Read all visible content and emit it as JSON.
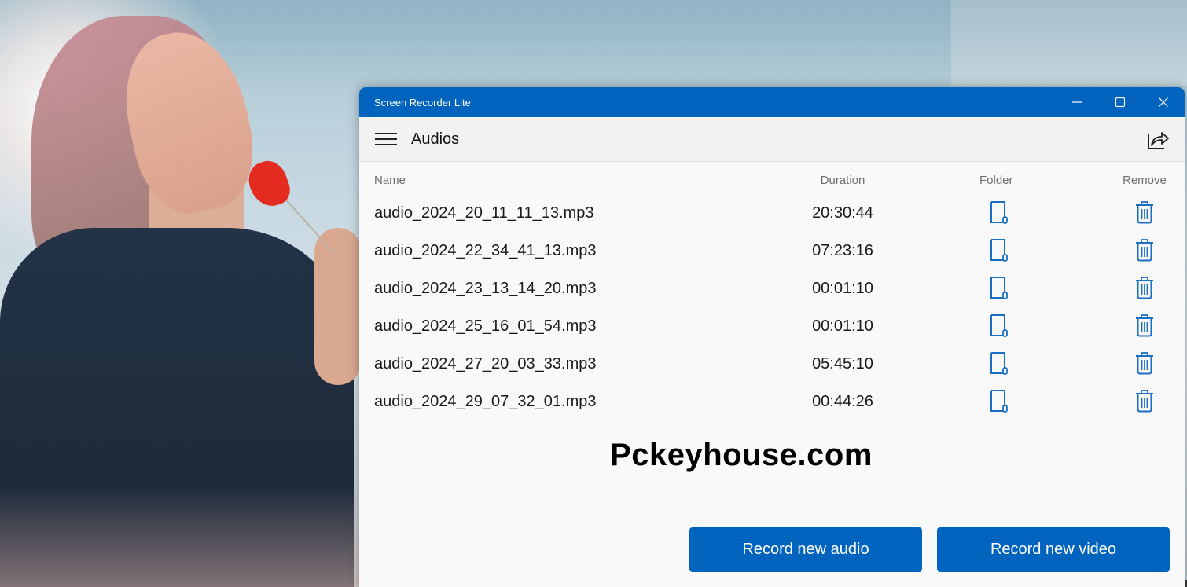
{
  "window": {
    "title": "Screen Recorder Lite",
    "controls": {
      "minimize": "minimize-icon",
      "maximize": "maximize-icon",
      "close": "close-icon"
    }
  },
  "appbar": {
    "menu_icon": "hamburger-menu-icon",
    "title": "Audios",
    "share_icon": "share-icon"
  },
  "table": {
    "columns": [
      "Name",
      "Duration",
      "Folder",
      "Remove"
    ],
    "rows": [
      {
        "name": "audio_2024_20_11_11_13.mp3",
        "duration": "20:30:44"
      },
      {
        "name": "audio_2024_22_34_41_13.mp3",
        "duration": "07:23:16"
      },
      {
        "name": "audio_2024_23_13_14_20.mp3",
        "duration": "00:01:10"
      },
      {
        "name": "audio_2024_25_16_01_54.mp3",
        "duration": "00:01:10"
      },
      {
        "name": "audio_2024_27_20_03_33.mp3",
        "duration": "05:45:10"
      },
      {
        "name": "audio_2024_29_07_32_01.mp3",
        "duration": "00:44:26"
      }
    ],
    "folder_icon": "open-folder-icon",
    "remove_icon": "trash-icon"
  },
  "watermark": "Pckeyhouse.com",
  "buttons": {
    "record_audio": "Record new audio",
    "record_video": "Record new video"
  },
  "colors": {
    "accent": "#0063be",
    "background": "#f9f9f9",
    "appbar": "#f2f2f2",
    "header_text": "#6f6f6f",
    "icon_blue": "#1a6fc4"
  }
}
